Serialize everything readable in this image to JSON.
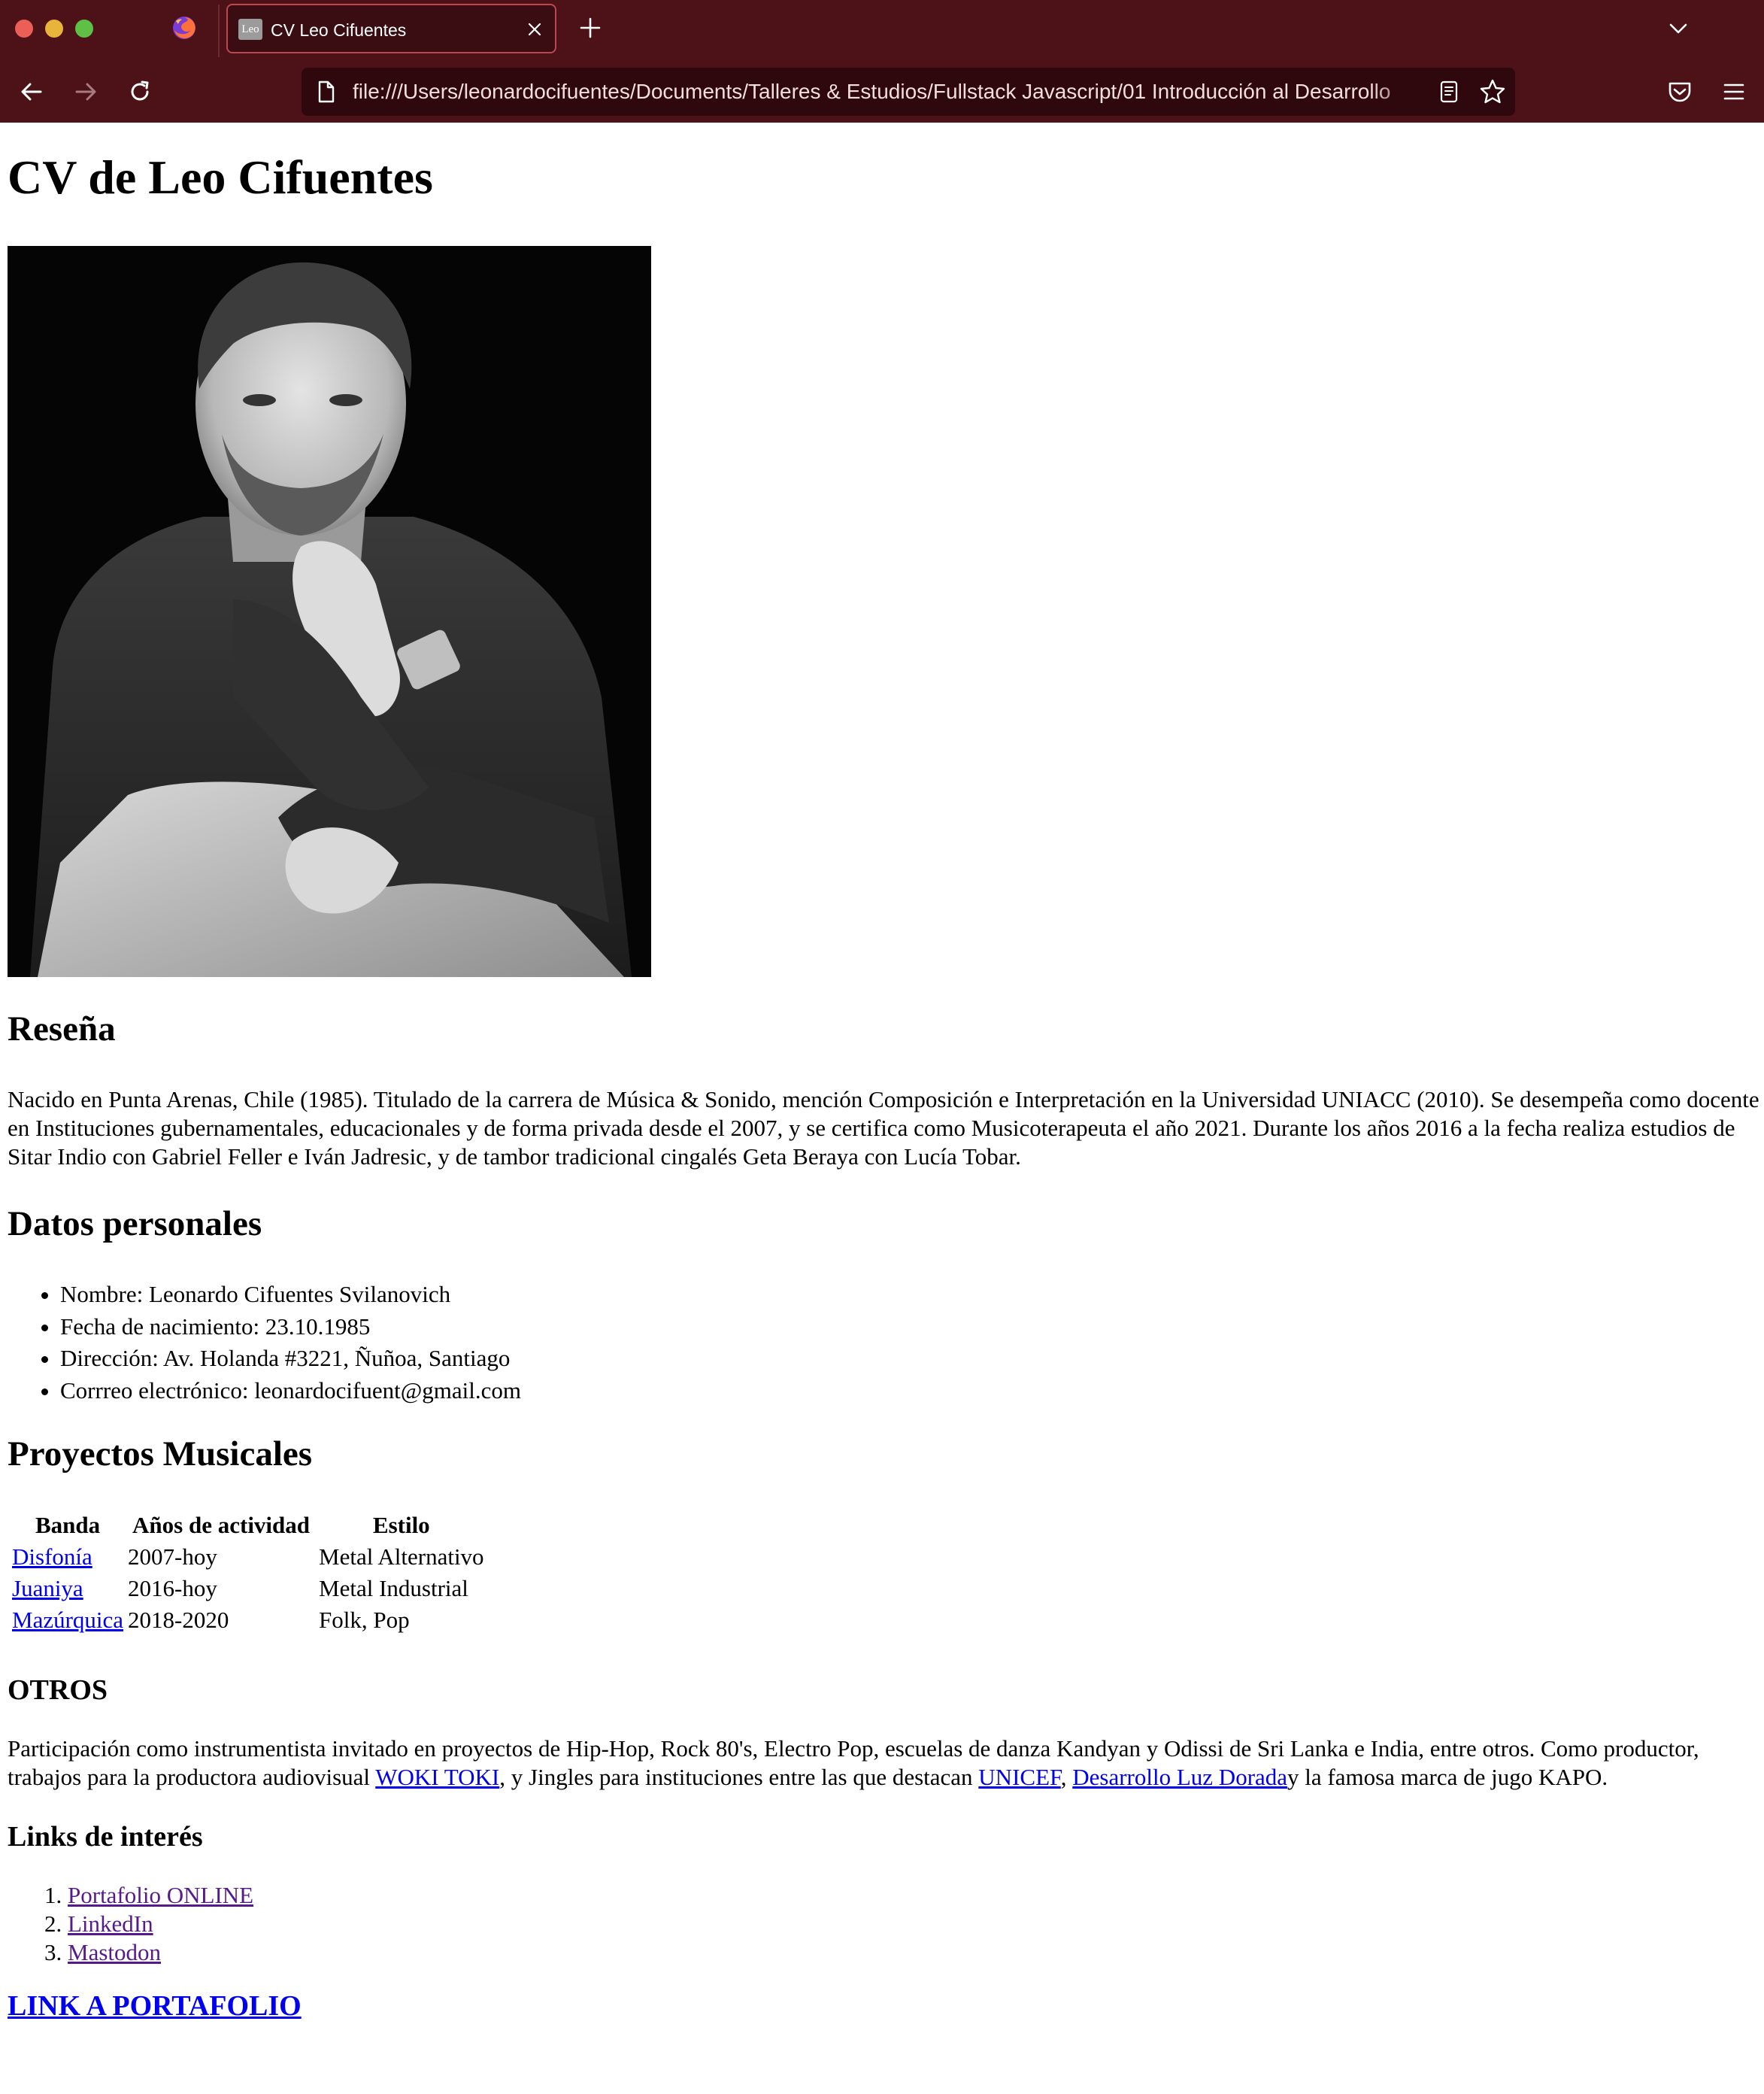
{
  "browser": {
    "tab_favicon_text": "Leo",
    "tab_title": "CV Leo Cifuentes",
    "url": "file:///Users/leonardocifuentes/Documents/Talleres & Estudios/Fullstack Javascript/01 Introducción al Desarrollo",
    "icons": [
      "firefox-logo-icon",
      "close-icon",
      "plus-icon",
      "chevron-down-icon",
      "back-arrow-icon",
      "forward-arrow-icon",
      "reload-icon",
      "page-icon",
      "reader-view-icon",
      "star-icon",
      "pocket-icon",
      "hamburger-menu-icon"
    ],
    "colors": {
      "chrome": "#4c1218",
      "urlbar": "#2e080c",
      "tab_active": "#3a0d13",
      "tab_border": "#c04552"
    }
  },
  "page": {
    "title": "CV de Leo Cifuentes",
    "photo_alt": "Leo Cifuentes",
    "resena": {
      "heading": "Reseña",
      "text": "Nacido en Punta Arenas, Chile (1985). Titulado de la carrera de Música & Sonido, mención Composición e Interpretación en la Universidad UNIACC (2010). Se desempeña como docente en Instituciones gubernamentales, educacionales y de forma privada desde el 2007, y se certifica como Musicoterapeuta el año 2021. Durante los años 2016 a la fecha realiza estudios de Sitar Indio con Gabriel Feller e Iván Jadresic, y de tambor tradicional cingalés Geta Beraya con Lucía Tobar."
    },
    "datos": {
      "heading": "Datos personales",
      "items": [
        "Nombre: Leonardo Cifuentes Svilanovich",
        "Fecha de nacimiento: 23.10.1985",
        "Dirección: Av. Holanda #3221, Ñuñoa, Santiago",
        "Corrreo electrónico: leonardocifuent@gmail.com"
      ]
    },
    "proyectos": {
      "heading": "Proyectos Musicales",
      "columns": [
        "Banda",
        "Años de actividad",
        "Estilo"
      ],
      "rows": [
        [
          "Disfonía",
          "2007-hoy",
          "Metal Alternativo"
        ],
        [
          "Juaniya",
          "2016-hoy",
          "Metal Industrial"
        ],
        [
          "Mazúrquica",
          "2018-2020",
          "Folk, Pop"
        ]
      ]
    },
    "otros": {
      "heading": "OTROS",
      "text_1": "Participación como instrumentista invitado en proyectos de Hip-Hop, Rock 80's, Electro Pop, escuelas de danza Kandyan y Odissi de Sri Lanka e India, entre otros. Como productor, trabajos para la productora audiovisual ",
      "link_1": "WOKI TOKI",
      "text_2": ", y Jingles para instituciones entre las que destacan ",
      "link_2": "UNICEF",
      "text_3": ", ",
      "link_3": "Desarrollo Luz Dorada",
      "text_4": "y la famosa marca de jugo KAPO."
    },
    "links": {
      "heading": "Links de interés",
      "items": [
        "Portafolio ONLINE",
        "LinkedIn",
        "Mastodon"
      ]
    },
    "portfolio_link": "LINK A PORTAFOLIO",
    "colors": {
      "link": "#0000ee",
      "visited_link": "#551a8b"
    }
  }
}
